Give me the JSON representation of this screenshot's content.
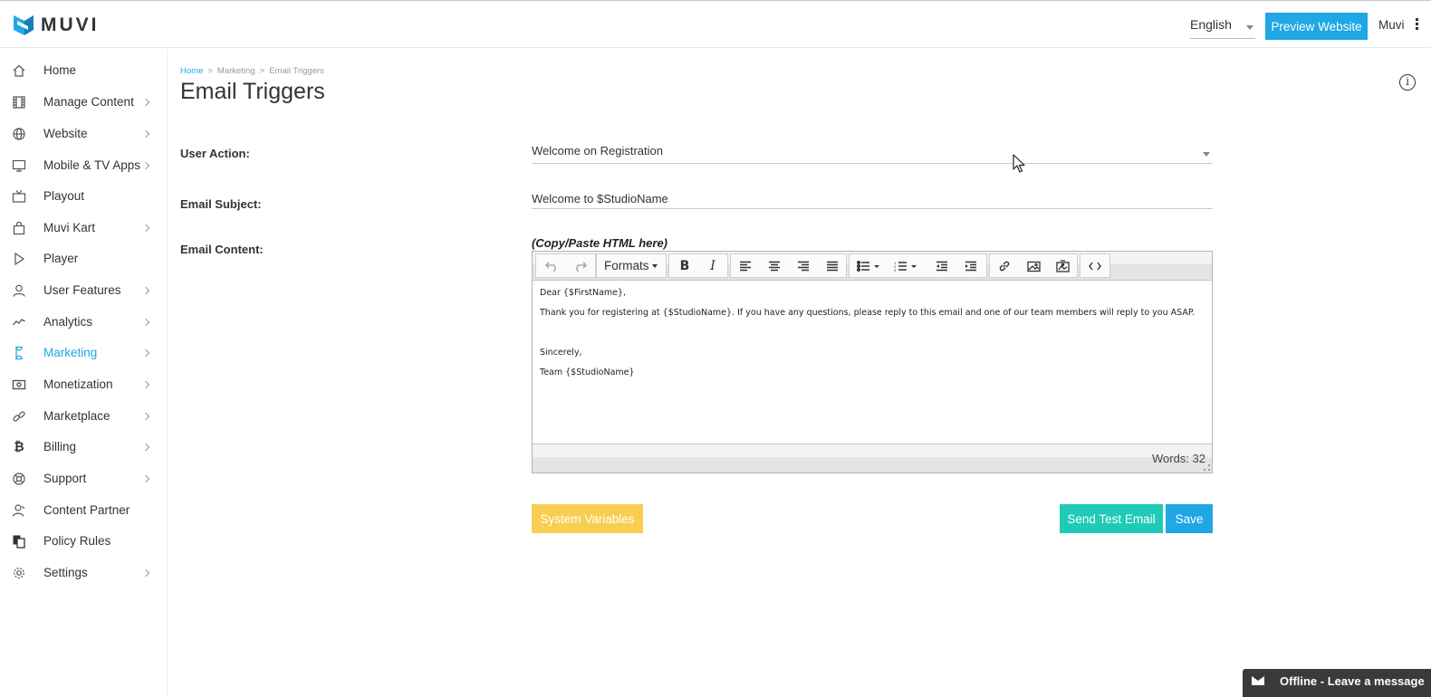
{
  "brand": {
    "name": "MUVI",
    "accent": "#1fa7e6"
  },
  "header": {
    "language": "English",
    "preview_label": "Preview Website",
    "user_name": "Muvi"
  },
  "sidebar": {
    "items": [
      {
        "label": "Home",
        "icon": "home-icon",
        "has_children": false
      },
      {
        "label": "Manage Content",
        "icon": "film-icon",
        "has_children": true
      },
      {
        "label": "Website",
        "icon": "globe-icon",
        "has_children": true
      },
      {
        "label": "Mobile & TV Apps",
        "icon": "monitor-icon",
        "has_children": true
      },
      {
        "label": "Playout",
        "icon": "tv-icon",
        "has_children": false
      },
      {
        "label": "Muvi Kart",
        "icon": "shopping-bag-icon",
        "has_children": true
      },
      {
        "label": "Player",
        "icon": "play-icon",
        "has_children": false
      },
      {
        "label": "User Features",
        "icon": "user-icon",
        "has_children": true
      },
      {
        "label": "Analytics",
        "icon": "chart-line-icon",
        "has_children": true
      },
      {
        "label": "Marketing",
        "icon": "hourglass-icon",
        "has_children": true,
        "active": true
      },
      {
        "label": "Monetization",
        "icon": "money-icon",
        "has_children": true
      },
      {
        "label": "Marketplace",
        "icon": "link-icon",
        "has_children": true
      },
      {
        "label": "Billing",
        "icon": "bitcoin-icon",
        "has_children": true
      },
      {
        "label": "Support",
        "icon": "lifebuoy-icon",
        "has_children": true
      },
      {
        "label": "Content Partner",
        "icon": "partner-icon",
        "has_children": false
      },
      {
        "label": "Policy Rules",
        "icon": "documents-icon",
        "has_children": false
      },
      {
        "label": "Settings",
        "icon": "gear-icon",
        "has_children": true
      }
    ]
  },
  "breadcrumb": {
    "home": "Home",
    "section": "Marketing",
    "current": "Email Triggers"
  },
  "page": {
    "title": "Email Triggers"
  },
  "form": {
    "user_action_label": "User Action:",
    "user_action_value": "Welcome on Registration",
    "subject_label": "Email Subject:",
    "subject_value": "Welcome to $StudioName",
    "content_label": "Email Content:",
    "content_hint": "(Copy/Paste HTML here)"
  },
  "editor": {
    "formats_label": "Formats",
    "body": {
      "greeting": "Dear {$FirstName},",
      "message": "Thank you for registering at {$StudioName}.  If you have any questions, please reply to this email and one of our team members will reply to you ASAP.",
      "closing": "Sincerely,",
      "signature": "Team {$StudioName}"
    },
    "word_count": "Words: 32"
  },
  "actions": {
    "system_variables": "System Variables",
    "send_test": "Send Test Email",
    "save": "Save"
  },
  "chat": {
    "label": "Offline - Leave a message"
  }
}
